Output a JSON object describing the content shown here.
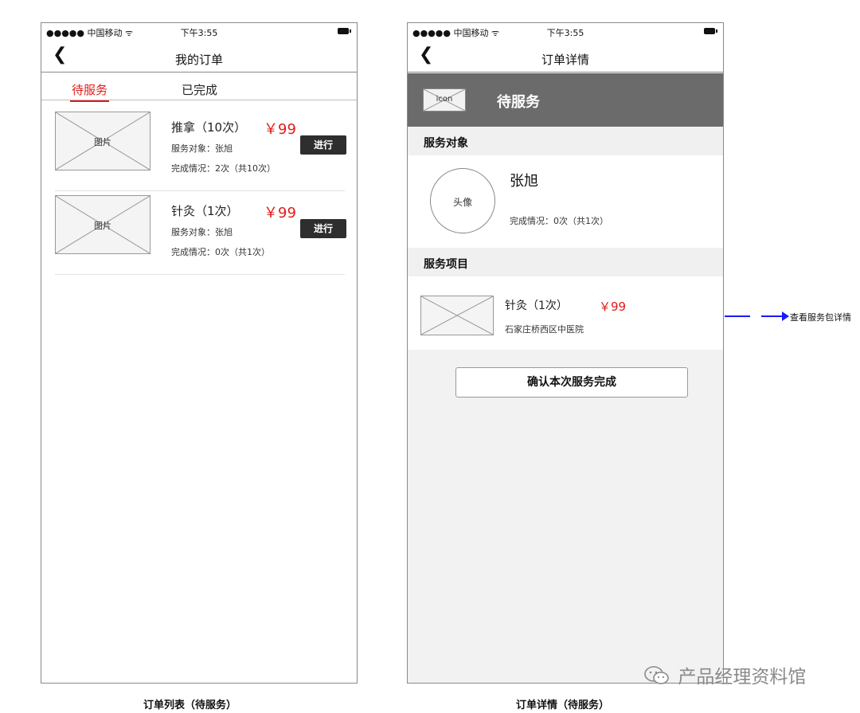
{
  "left": {
    "status": {
      "carrier": "●●●●● 中国移动 ᯤ",
      "time": "下午3:55"
    },
    "nav": {
      "back": "❮",
      "title": "我的订单"
    },
    "tabs": [
      {
        "label": "待服务"
      },
      {
        "label": "已完成"
      }
    ],
    "orders": [
      {
        "image_label": "图片",
        "name": "推拿（10次）",
        "price": "￥99",
        "target": "服务对象：张旭",
        "progress": "完成情况：2次（共10次）",
        "button": "进行"
      },
      {
        "image_label": "图片",
        "name": "针灸（1次）",
        "price": "￥99",
        "target": "服务对象：张旭",
        "progress": "完成情况：0次（共1次）",
        "button": "进行"
      }
    ],
    "caption": "订单列表（待服务）"
  },
  "right": {
    "status": {
      "carrier": "●●●●● 中国移动 ᯤ",
      "time": "下午3:55"
    },
    "nav": {
      "back": "❮",
      "title": "订单详情"
    },
    "header": {
      "icon_label": "icon",
      "status": "待服务"
    },
    "target_section": {
      "title": "服务对象",
      "avatar_label": "头像",
      "name": "张旭",
      "progress": "完成情况：0次（共1次）"
    },
    "item_section": {
      "title": "服务项目",
      "name": "针灸（1次）",
      "price": "￥99",
      "place": "石家庄桥西区中医院"
    },
    "confirm_button": "确认本次服务完成",
    "caption": "订单详情（待服务）"
  },
  "annotation": {
    "text": "查看服务包详情"
  },
  "watermark": {
    "text": "产品经理资料馆"
  },
  "colors": {
    "accent": "#e11b1b",
    "header_bg": "#6b6b6b",
    "button_dark": "#2e2e2e",
    "annotation": "#1a1aff"
  }
}
